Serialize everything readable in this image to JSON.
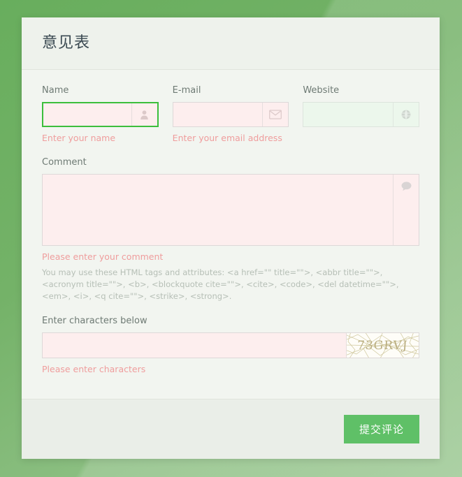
{
  "page": {
    "background_color_top": "#68ae5d",
    "background_color_bottom": "#9cc893",
    "card_background": "#f1f4ef"
  },
  "header": {
    "title": "意见表"
  },
  "form": {
    "name": {
      "label": "Name",
      "value": "",
      "placeholder": "",
      "error": "Enter your name",
      "icon": "user-icon",
      "state": "error-focused"
    },
    "email": {
      "label": "E-mail",
      "value": "",
      "placeholder": "",
      "error": "Enter your email address",
      "icon": "envelope-icon",
      "state": "error"
    },
    "website": {
      "label": "Website",
      "value": "",
      "placeholder": "",
      "error": "",
      "icon": "globe-icon",
      "state": "ok"
    },
    "comment": {
      "label": "Comment",
      "value": "",
      "placeholder": "",
      "error": "Please enter your comment",
      "icon": "speech-bubble-icon",
      "state": "error"
    },
    "help_text": "You may use these HTML tags and attributes: <a href=\"\" title=\"\">, <abbr title=\"\">, <acronym title=\"\">, <b>, <blockquote cite=\"\">, <cite>, <code>, <del datetime=\"\">, <em>, <i>, <q cite=\"\">, <strike>, <strong>.",
    "captcha": {
      "label": "Enter characters below",
      "value": "",
      "placeholder": "",
      "error": "Please enter characters",
      "code": "73GRVJ",
      "state": "error"
    }
  },
  "footer": {
    "submit_label": "提交评论",
    "submit_color": "#5fc067"
  },
  "colors": {
    "error_text": "#ef9d9d",
    "error_field_bg": "#fdeeee",
    "focus_border": "#3cbe3c",
    "label_text": "#6e7a74",
    "help_text": "#b6bfb6"
  }
}
